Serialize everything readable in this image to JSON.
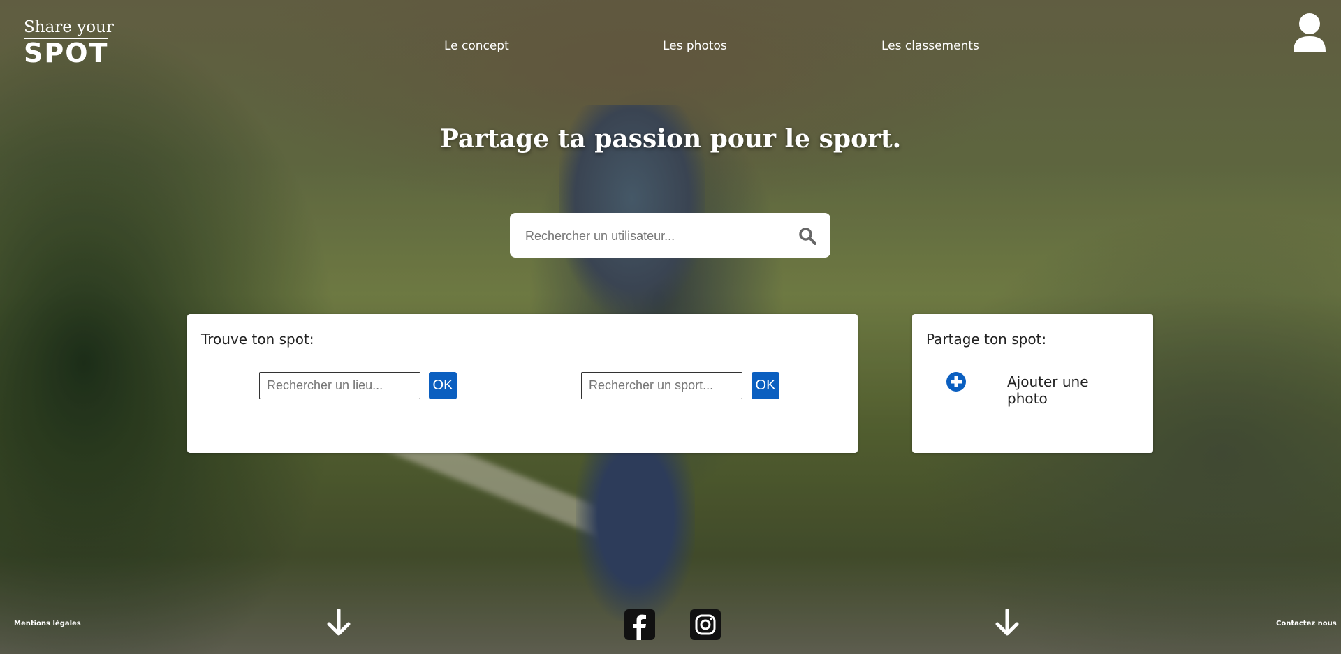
{
  "header": {
    "logo_top": "Share your",
    "logo_bottom": "SPOT",
    "nav": [
      "Le concept",
      "Les photos",
      "Les classements"
    ]
  },
  "hero": {
    "headline": "Partage ta passion pour le sport.",
    "user_search_placeholder": "Rechercher un utilisateur..."
  },
  "find_card": {
    "title": "Trouve ton spot:",
    "place_placeholder": "Rechercher un lieu...",
    "sport_placeholder": "Rechercher un sport...",
    "ok_label": "OK"
  },
  "share_card": {
    "title": "Partage ton spot:",
    "add_photo_label": "Ajouter une photo"
  },
  "footer": {
    "legal": "Mentions légales",
    "contact": "Contactez nous"
  },
  "icons": [
    "user-icon",
    "search-icon",
    "plus-circle-icon",
    "arrow-down-icon",
    "facebook-icon",
    "instagram-icon"
  ],
  "colors": {
    "accent": "#0b5fc0",
    "text_light": "#ffffff"
  }
}
